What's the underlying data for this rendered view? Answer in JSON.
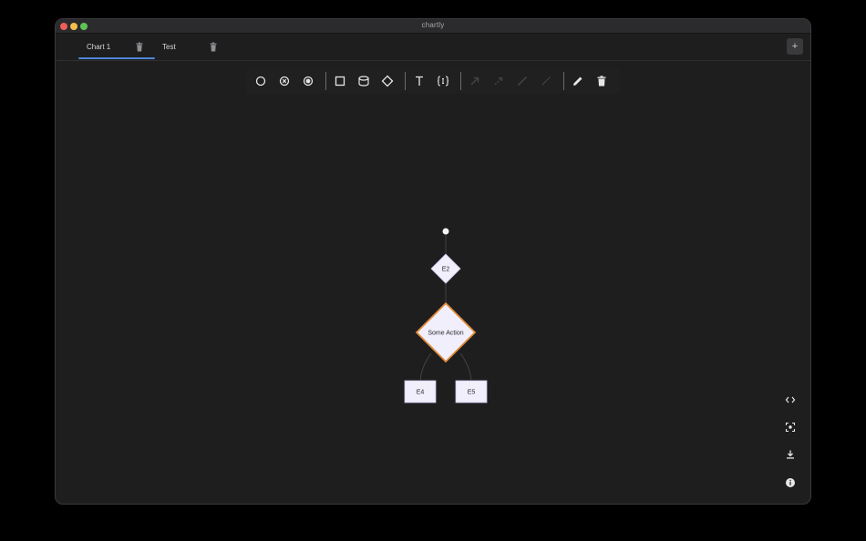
{
  "window": {
    "title": "chartly"
  },
  "tabs": [
    {
      "label": "Chart 1",
      "active": true
    },
    {
      "label": "Test",
      "active": false
    }
  ],
  "add_tab_label": "+",
  "toolbar": {
    "tools": [
      {
        "icon": "circle-icon",
        "enabled": true
      },
      {
        "icon": "circle-x-icon",
        "enabled": true
      },
      {
        "icon": "circle-dot-icon",
        "enabled": true
      },
      {
        "icon": "square-icon",
        "enabled": true
      },
      {
        "icon": "cylinder-icon",
        "enabled": true
      },
      {
        "icon": "diamond-icon",
        "enabled": true
      },
      {
        "icon": "text-icon",
        "enabled": true
      },
      {
        "icon": "code-braces-icon",
        "enabled": true
      },
      {
        "icon": "arrow-diagonal-icon",
        "enabled": false
      },
      {
        "icon": "dashed-arrow-icon",
        "enabled": false
      },
      {
        "icon": "line-icon",
        "enabled": false
      },
      {
        "icon": "thin-line-icon",
        "enabled": false
      },
      {
        "icon": "pencil-icon",
        "enabled": true
      },
      {
        "icon": "trash-icon",
        "enabled": true
      }
    ]
  },
  "diagram": {
    "nodes": [
      {
        "id": "start",
        "type": "start"
      },
      {
        "id": "E2",
        "type": "decision",
        "label": "E2"
      },
      {
        "id": "action",
        "type": "decision",
        "label": "Some Action",
        "selected": true
      },
      {
        "id": "E4",
        "type": "process",
        "label": "E4"
      },
      {
        "id": "E5",
        "type": "process",
        "label": "E5"
      }
    ],
    "edges": [
      {
        "from": "start",
        "to": "E2"
      },
      {
        "from": "E2",
        "to": "action"
      },
      {
        "from": "action",
        "to": "E4"
      },
      {
        "from": "action",
        "to": "E5"
      }
    ],
    "colors": {
      "node_fill": "#f1effc",
      "selected_border": "#e08a3a",
      "edge": "#4a4a4e"
    }
  },
  "side_buttons": [
    {
      "icon": "code-icon"
    },
    {
      "icon": "fit-view-icon"
    },
    {
      "icon": "download-icon"
    },
    {
      "icon": "info-icon"
    }
  ]
}
